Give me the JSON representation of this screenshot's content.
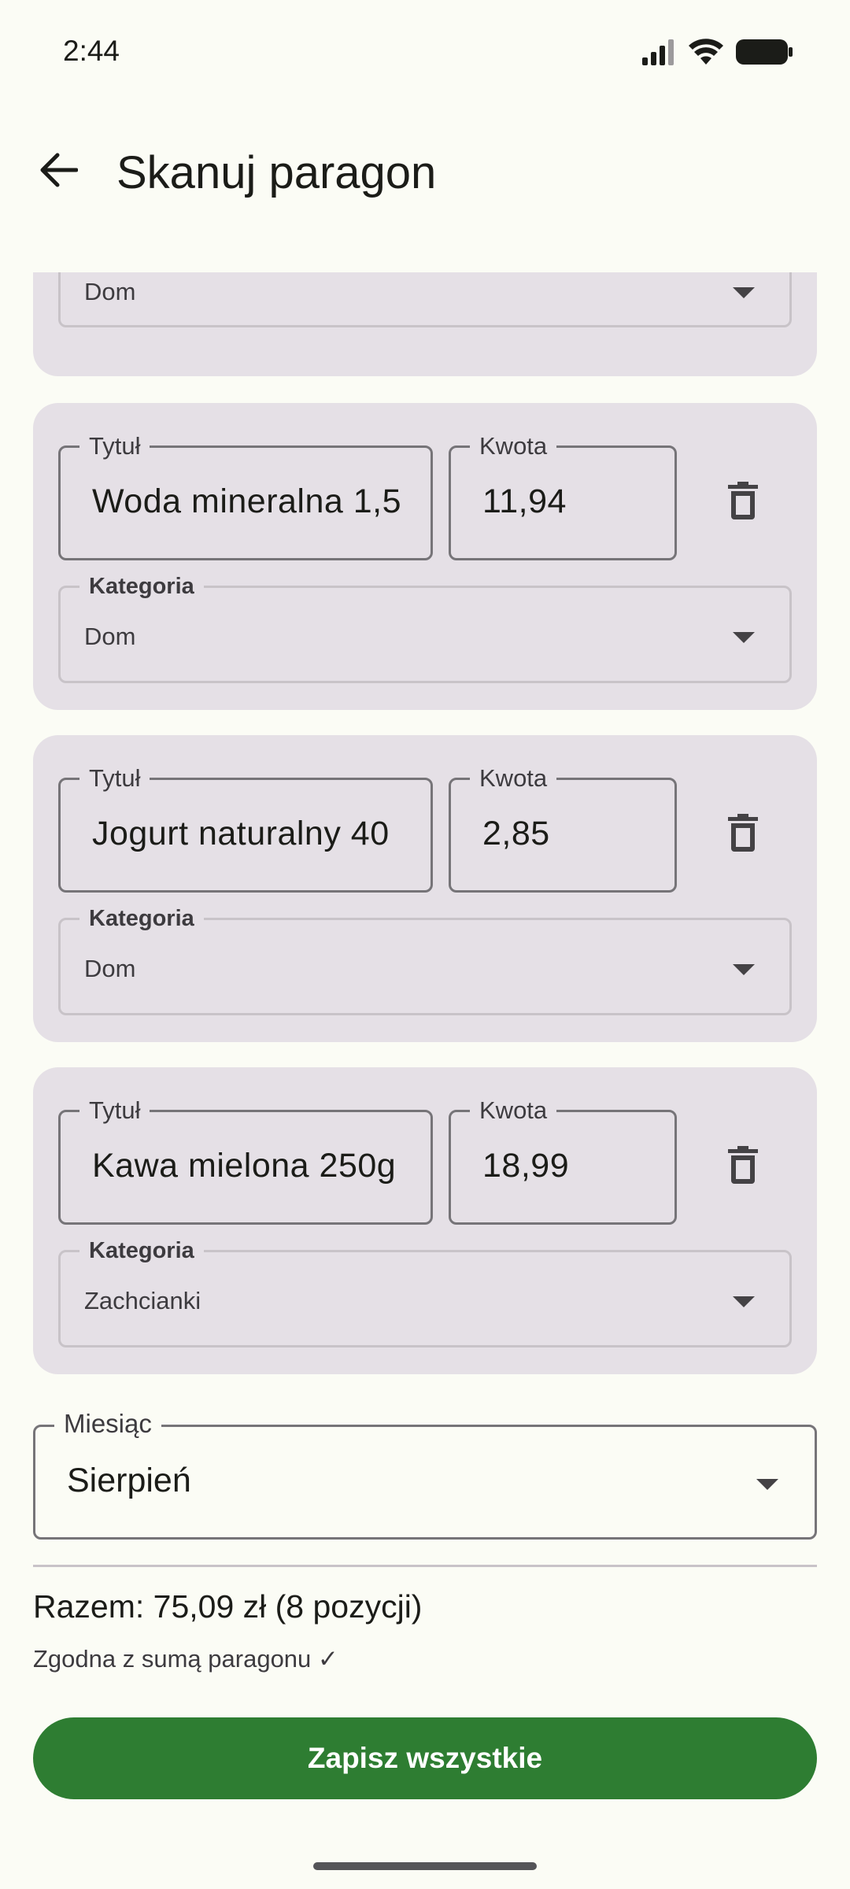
{
  "status_bar": {
    "time": "2:44",
    "icons": [
      "signal-icon",
      "wifi-icon",
      "battery-icon"
    ]
  },
  "app_bar": {
    "title": "Skanuj paragon",
    "back_icon": "arrow-back-icon"
  },
  "partial_item": {
    "category_value": "Dom"
  },
  "items": [
    {
      "title_label": "Tytuł",
      "title_value": "Woda mineralna 1,5",
      "amount_label": "Kwota",
      "amount_value": "11,94",
      "category_label": "Kategoria",
      "category_value": "Dom"
    },
    {
      "title_label": "Tytuł",
      "title_value": "Jogurt naturalny 40",
      "amount_label": "Kwota",
      "amount_value": "2,85",
      "category_label": "Kategoria",
      "category_value": "Dom"
    },
    {
      "title_label": "Tytuł",
      "title_value": "Kawa mielona 250g",
      "amount_label": "Kwota",
      "amount_value": "18,99",
      "category_label": "Kategoria",
      "category_value": "Zachcianki"
    }
  ],
  "month": {
    "label": "Miesiąc",
    "value": "Sierpień"
  },
  "summary": {
    "total": "Razem: 75,09 zł (8 pozycji)",
    "match": "Zgodna z sumą paragonu ✓"
  },
  "actions": {
    "save_label": "Zapisz wszystkie"
  },
  "colors": {
    "background": "#fbfcf5",
    "card": "#e5e0e6",
    "primary_button": "#2e7d32"
  }
}
